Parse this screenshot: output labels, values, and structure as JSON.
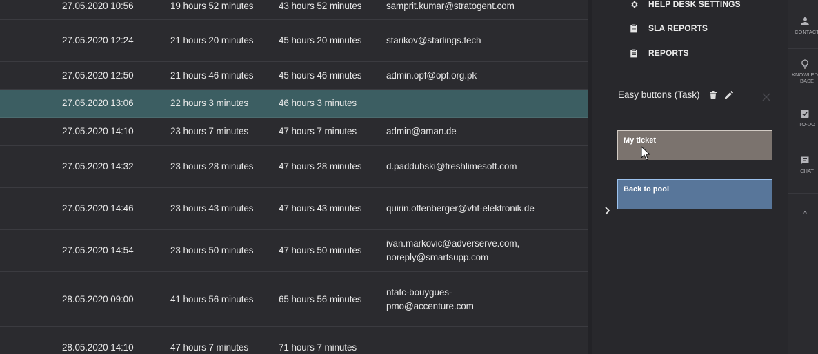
{
  "table": {
    "rows": [
      {
        "date": "27.05.2020 10:56",
        "response": "19 hours 52 minutes",
        "resolution": "43 hours 52 minutes",
        "email": "samprit.kumar@stratogent.com",
        "selected": false
      },
      {
        "date": "27.05.2020 12:24",
        "response": "21 hours 20 minutes",
        "resolution": "45 hours 20 minutes",
        "email": "starikov@starlings.tech",
        "selected": false
      },
      {
        "date": "27.05.2020 12:50",
        "response": "21 hours 46 minutes",
        "resolution": "45 hours 46 minutes",
        "email": "admin.opf@opf.org.pk",
        "selected": false
      },
      {
        "date": "27.05.2020 13:06",
        "response": "22 hours 3 minutes",
        "resolution": "46 hours 3 minutes",
        "email": "",
        "selected": true
      },
      {
        "date": "27.05.2020 14:10",
        "response": "23 hours 7 minutes",
        "resolution": "47 hours 7 minutes",
        "email": "admin@aman.de",
        "selected": false
      },
      {
        "date": "27.05.2020 14:32",
        "response": "23 hours 28 minutes",
        "resolution": "47 hours 28 minutes",
        "email": "d.paddubski@freshlimesoft.com",
        "selected": false
      },
      {
        "date": "27.05.2020 14:46",
        "response": "23 hours 43 minutes",
        "resolution": "47 hours 43 minutes",
        "email": "quirin.offenberger@vhf-elektronik.de",
        "selected": false
      },
      {
        "date": "27.05.2020 14:54",
        "response": "23 hours 50 minutes",
        "resolution": "47 hours 50 minutes",
        "email": "ivan.markovic@adverserve.com, noreply@smartsupp.com",
        "selected": false
      },
      {
        "date": "28.05.2020 09:00",
        "response": "41 hours 56 minutes",
        "resolution": "65 hours 56 minutes",
        "email": "ntatc-bouygues-pmo@accenture.com",
        "selected": false
      },
      {
        "date": "28.05.2020 14:10",
        "response": "47 hours 7 minutes",
        "resolution": "71 hours 7 minutes",
        "email": "",
        "selected": false
      }
    ]
  },
  "menu": {
    "items": [
      {
        "label": "HELP DESK SETTINGS",
        "icon": "gear-icon"
      },
      {
        "label": "SLA REPORTS",
        "icon": "clipboard-icon"
      },
      {
        "label": "REPORTS",
        "icon": "clipboard-icon"
      }
    ]
  },
  "easy_buttons": {
    "title": "Easy buttons (Task)",
    "buttons": [
      {
        "label": "My ticket",
        "color": "#7b736e"
      },
      {
        "label": "Back to pool",
        "color": "#58769a"
      }
    ]
  },
  "sidebar": {
    "items": [
      {
        "label": "CONTACT",
        "icon": "person-icon"
      },
      {
        "label": "KNOWLEDGE BASE",
        "icon": "lightbulb-icon"
      },
      {
        "label": "TO-DO",
        "icon": "checklist-icon"
      },
      {
        "label": "CHAT",
        "icon": "chat-icon"
      }
    ]
  },
  "colors": {
    "selected_row": "#3c5e62",
    "my_ticket": "#7b736e",
    "back_to_pool": "#58769a"
  }
}
